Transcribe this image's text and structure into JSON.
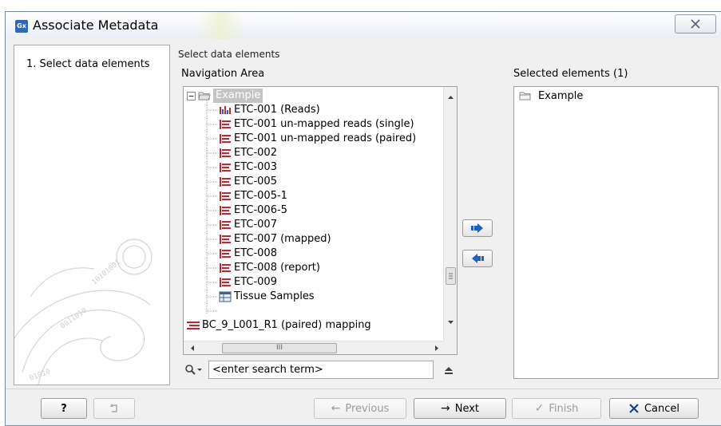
{
  "window": {
    "title": "Associate Metadata",
    "app_icon_text": "Gx",
    "close_icon": "close-x-icon"
  },
  "steps": [
    {
      "label": "1.  Select data elements",
      "active": true
    }
  ],
  "main": {
    "section_label": "Select data elements",
    "navigation_label": "Navigation Area",
    "selected_label": "Selected elements (1)",
    "tree": [
      {
        "label": "Example",
        "icon": "folder-open-icon",
        "selected": true,
        "level": 0
      },
      {
        "label": "ETC-001 (Reads)",
        "icon": "reads-icon",
        "level": 1
      },
      {
        "label": "ETC-001 un-mapped reads (single)",
        "icon": "sequence-list-icon",
        "level": 1
      },
      {
        "label": "ETC-001 un-mapped reads (paired)",
        "icon": "sequence-list-icon",
        "level": 1
      },
      {
        "label": "ETC-002",
        "icon": "sequence-list-icon",
        "level": 1
      },
      {
        "label": "ETC-003",
        "icon": "sequence-list-icon",
        "level": 1
      },
      {
        "label": "ETC-005",
        "icon": "sequence-list-icon",
        "level": 1
      },
      {
        "label": "ETC-005-1",
        "icon": "sequence-list-icon",
        "level": 1
      },
      {
        "label": "ETC-006-5",
        "icon": "sequence-list-icon",
        "level": 1
      },
      {
        "label": "ETC-007",
        "icon": "sequence-list-icon",
        "level": 1
      },
      {
        "label": "ETC-007 (mapped)",
        "icon": "sequence-list-icon",
        "level": 1
      },
      {
        "label": "ETC-008",
        "icon": "sequence-list-icon",
        "level": 1
      },
      {
        "label": "ETC-008 (report)",
        "icon": "sequence-list-icon",
        "level": 1
      },
      {
        "label": "ETC-009",
        "icon": "sequence-list-icon",
        "level": 1
      },
      {
        "label": "Tissue Samples",
        "icon": "metadata-table-icon",
        "level": 1
      },
      {
        "label": "BC_9_L001_R1 (paired) mapping",
        "icon": "mapping-icon",
        "level": 0
      }
    ],
    "search": {
      "placeholder": "<enter search term>",
      "value": ""
    },
    "selected_elements": [
      {
        "label": "Example",
        "icon": "folder-icon"
      }
    ],
    "hscroll_grip": "III"
  },
  "buttons": {
    "help": "?",
    "previous": "Previous",
    "next": "Next",
    "finish": "Finish",
    "cancel": "Cancel"
  },
  "colors": {
    "tree_selection": "#c4c4c4",
    "sequence_icon": "#d0202a",
    "move_arrow": "#1f5fc4",
    "cancel_x": "#1b3f8c"
  }
}
